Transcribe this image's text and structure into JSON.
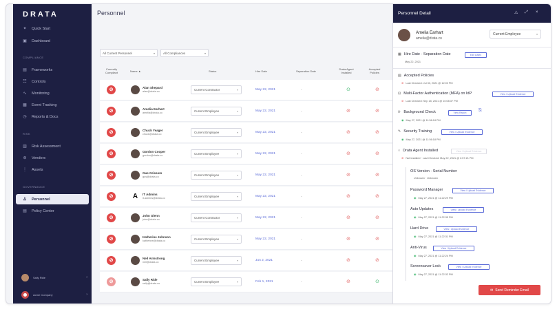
{
  "app": {
    "logo": "DRATA"
  },
  "sidebar": {
    "items": [
      {
        "label": "Quick Start",
        "icon": "sparkle-icon"
      },
      {
        "label": "Dashboard",
        "icon": "dashboard-icon"
      }
    ],
    "compliance_label": "COMPLIANCE",
    "compliance_items": [
      {
        "label": "Frameworks",
        "icon": "frameworks-icon"
      },
      {
        "label": "Controls",
        "icon": "controls-icon"
      },
      {
        "label": "Monitoring",
        "icon": "monitoring-icon"
      },
      {
        "label": "Event Tracking",
        "icon": "calendar-icon"
      },
      {
        "label": "Reports & Docs",
        "icon": "reports-icon"
      }
    ],
    "risk_label": "RISK",
    "risk_items": [
      {
        "label": "Risk Assessment",
        "icon": "risk-icon"
      },
      {
        "label": "Vendors",
        "icon": "vendors-icon"
      },
      {
        "label": "Assets",
        "icon": "assets-icon"
      }
    ],
    "governance_label": "GOVERNANCE",
    "governance_items": [
      {
        "label": "Personnel",
        "icon": "personnel-icon",
        "active": true
      },
      {
        "label": "Policy Center",
        "icon": "policy-icon"
      }
    ],
    "user_name": "Sally Ride",
    "company_name": "Acme Company"
  },
  "main": {
    "title": "Personnel",
    "filters": [
      {
        "label": "All Current Personnel"
      },
      {
        "label": "All Compliances"
      }
    ],
    "headers": {
      "compliant": "Currently Compliant",
      "name": "Name ▲",
      "status": "Status",
      "hire": "Hire Date",
      "separation": "Separation Date",
      "agent": "Drata Agent Installed",
      "policies": "Accepted Policies"
    },
    "rows": [
      {
        "name": "Alan Shepard",
        "email": "alan@drata.co",
        "status": "Current Contractor",
        "hire": "May 22, 2021",
        "sep": "-",
        "agent_ok": true,
        "policies_ok": false
      },
      {
        "name": "Amelia Earhart",
        "email": "amelia@drata.co",
        "status": "Current Employee",
        "hire": "May 22, 2021",
        "sep": "-",
        "agent_ok": false,
        "policies_ok": false
      },
      {
        "name": "Chuck Yeager",
        "email": "chuck@drata.co",
        "status": "Current Employee",
        "hire": "May 22, 2021",
        "sep": "-",
        "agent_ok": false,
        "policies_ok": false
      },
      {
        "name": "Gordon Cooper",
        "email": "gordon@drata.co",
        "status": "Current Employee",
        "hire": "May 22, 2021",
        "sep": "-",
        "agent_ok": false,
        "policies_ok": false
      },
      {
        "name": "Gus Grissom",
        "email": "gus@drata.co",
        "status": "Current Employee",
        "hire": "May 22, 2021",
        "sep": "-",
        "agent_ok": false,
        "policies_ok": false
      },
      {
        "name": "IT Admins",
        "email": "it.admins@drata.co",
        "status": "Current Employee",
        "hire": "May 22, 2021",
        "sep": "-",
        "agent_ok": false,
        "policies_ok": false
      },
      {
        "name": "John Glenn",
        "email": "john@drata.co",
        "status": "Current Contractor",
        "hire": "May 22, 2021",
        "sep": "-",
        "agent_ok": false,
        "policies_ok": false
      },
      {
        "name": "Katherine Johnson",
        "email": "katherine@drata.co",
        "status": "Current Employee",
        "hire": "May 22, 2021",
        "sep": "-",
        "agent_ok": false,
        "policies_ok": false
      },
      {
        "name": "Neil Armstrong",
        "email": "neil@drata.co",
        "status": "Current Employee",
        "hire": "Jun 2, 2021",
        "sep": "-",
        "agent_ok": false,
        "policies_ok": false
      },
      {
        "name": "Sally Ride",
        "email": "sally@drata.co",
        "status": "Current Employee",
        "hire": "Feb 1, 2021",
        "sep": "-",
        "agent_ok": false,
        "policies_ok": true
      }
    ]
  },
  "panel": {
    "title": "Personnel Detail",
    "person_name": "Amelia Earhart",
    "person_email": "amelia@drata.co",
    "person_status": "Current Employee",
    "hire_section": "Hire Date · Separation Date",
    "hire_btn": "Edit Dates",
    "hire_value": "May 22, 2021",
    "policies_title": "Accepted Policies",
    "policies_sub": "Last Checked: Jul 30, 2021 @ 12:00 PM",
    "mfa_title": "Multi-Factor Authentication (MFA) on IdP",
    "mfa_btn": "View / Upload Evidence",
    "mfa_sub": "Last Checked: Sep 18, 2021 @ 10:08:37 PM",
    "bg_title": "Background Check",
    "bg_btn": "View Report",
    "bg_sub": "May 27, 2021 @ 11:56:24 PM",
    "sec_title": "Security Training",
    "sec_btn": "View / Upload Evidence",
    "sec_sub": "May 27, 2021 @ 11:56:18 PM",
    "agent_title": "Drata Agent Installed",
    "agent_btn": "View / Upload Evidence",
    "agent_sub": "Not Installed · Last Checked: May 22, 2021 @ 2:57:21 PM",
    "os_title": "OS Version · Serial Number",
    "os_value": "Unknown · Unknown",
    "pm_title": "Password Manager",
    "pm_btn": "View / Upload Evidence",
    "pm_sub": "May 27, 2021 @ 11:22:29 PM",
    "au_title": "Auto Updates",
    "au_btn": "View / Upload Evidence",
    "au_sub": "May 27, 2021 @ 11:22:35 PM",
    "hd_title": "Hard Drive",
    "hd_btn": "View / Upload Evidence",
    "hd_sub": "May 27, 2021 @ 11:22:31 PM",
    "av_title": "Anti-Virus",
    "av_btn": "View / Upload Evidence",
    "av_sub": "May 27, 2021 @ 11:22:24 PM",
    "sl_title": "Screensaver Lock",
    "sl_btn": "View / Upload Evidence",
    "sl_sub": "May 27, 2021 @ 11:22:32 PM",
    "send_btn": "Send Reminder Email"
  },
  "colors": {
    "sidebar": "#1d1f42",
    "accent": "#5b6bd8",
    "danger": "#e14848",
    "success": "#3bb56a"
  }
}
